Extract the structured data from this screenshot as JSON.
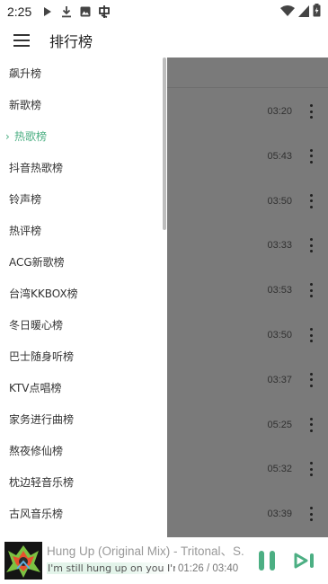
{
  "status_bar": {
    "time": "2:25",
    "icons": [
      "play-icon",
      "download-icon",
      "photo-icon",
      "app-icon",
      "wifi-icon",
      "signal-icon",
      "battery-icon"
    ]
  },
  "app_bar": {
    "title": "排行榜"
  },
  "drawer": {
    "items": [
      {
        "label": "飙升榜",
        "selected": false
      },
      {
        "label": "新歌榜",
        "selected": false
      },
      {
        "label": "热歌榜",
        "selected": true
      },
      {
        "label": "抖音热歌榜",
        "selected": false
      },
      {
        "label": "铃声榜",
        "selected": false
      },
      {
        "label": "热评榜",
        "selected": false
      },
      {
        "label": "ACG新歌榜",
        "selected": false
      },
      {
        "label": "台湾KKBOX榜",
        "selected": false
      },
      {
        "label": "冬日暖心榜",
        "selected": false
      },
      {
        "label": "巴士随身听榜",
        "selected": false
      },
      {
        "label": "KTV点唱榜",
        "selected": false
      },
      {
        "label": "家务进行曲榜",
        "selected": false
      },
      {
        "label": "熬夜修仙榜",
        "selected": false
      },
      {
        "label": "枕边轻音乐榜",
        "selected": false
      },
      {
        "label": "古风音乐榜",
        "selected": false
      }
    ]
  },
  "songs": [
    {
      "duration": "03:20"
    },
    {
      "duration": "05:43"
    },
    {
      "duration": "03:50"
    },
    {
      "duration": "03:33"
    },
    {
      "duration": "03:53"
    },
    {
      "duration": "03:50"
    },
    {
      "duration": "03:37"
    },
    {
      "duration": "05:25"
    },
    {
      "duration": "05:32"
    },
    {
      "duration": "03:39"
    }
  ],
  "player": {
    "title": "Hung Up (Original Mix) - Tritonal、S...",
    "lyric": "I'm still hung up on you I'm ...",
    "time": "01:26 / 03:40",
    "accent_color": "#4caf83"
  }
}
